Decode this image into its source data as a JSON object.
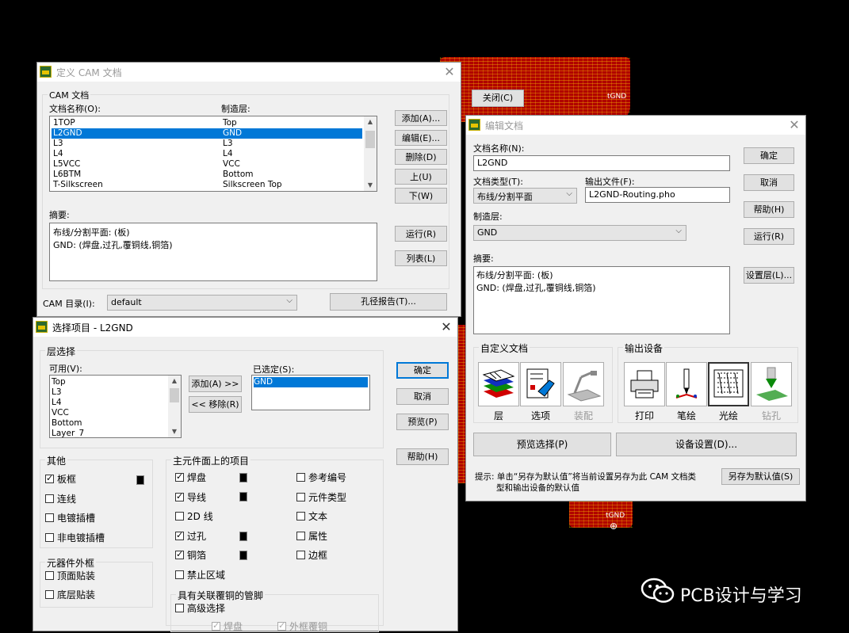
{
  "cam_window": {
    "title": "定义 CAM 文档",
    "group_label": "CAM 文档",
    "col_doc_name": "文档名称(O):",
    "col_layer": "制造层:",
    "documents": [
      {
        "name": "1TOP",
        "layer": "Top"
      },
      {
        "name": "L2GND",
        "layer": "GND",
        "selected": true
      },
      {
        "name": "L3",
        "layer": "L3"
      },
      {
        "name": "L4",
        "layer": "L4"
      },
      {
        "name": "L5VCC",
        "layer": "VCC"
      },
      {
        "name": "L6BTM",
        "layer": "Bottom"
      },
      {
        "name": "T-Silkscreen",
        "layer": "Silkscreen Top"
      }
    ],
    "summary_label": "摘要:",
    "summary_line1": "布线/分割平面: (板)",
    "summary_line2": "GND: (焊盘,过孔,覆铜线,铜箔)",
    "btn_close": "关闭(C)",
    "btn_add": "添加(A)...",
    "btn_edit": "编辑(E)...",
    "btn_delete": "删除(D)",
    "btn_up": "上(U)",
    "btn_down": "下(W)",
    "btn_run": "运行(R)",
    "btn_list": "列表(L)",
    "dir_label": "CAM 目录(I):",
    "dir_value": "default",
    "btn_drill_report": "孔径报告(T)..."
  },
  "edit_window": {
    "title": "编辑文档",
    "doc_name_label": "文档名称(N):",
    "doc_name_value": "L2GND",
    "doc_type_label": "文档类型(T):",
    "doc_type_value": "布线/分割平面",
    "output_file_label": "输出文件(F):",
    "output_file_value": "L2GND-Routing.pho",
    "layer_label": "制造层:",
    "layer_value": "GND",
    "summary_label": "摘要:",
    "summary_line1": "布线/分割平面: (板)",
    "summary_line2": "GND: (焊盘,过孔,覆铜线,铜箔)",
    "btn_ok": "确定",
    "btn_cancel": "取消",
    "btn_help": "帮助(H)",
    "btn_run": "运行(R)",
    "btn_layers": "设置层(L)...",
    "custom_group": "自定义文档",
    "custom_items": [
      "层",
      "选项",
      "装配"
    ],
    "output_group": "输出设备",
    "output_items": [
      "打印",
      "笔绘",
      "光绘",
      "钻孔"
    ],
    "btn_preview": "预览选择(P)",
    "btn_device_setup": "设备设置(D)...",
    "hint_line1": "提示: 单击“另存为默认值”将当前设置另存为此 CAM 文档类",
    "hint_line2": "型和输出设备的默认值",
    "btn_save_default": "另存为默认值(S)"
  },
  "select_window": {
    "title": "选择项目 - L2GND",
    "layer_group": "层选择",
    "available_label": "可用(V):",
    "available": [
      "Top",
      "L3",
      "L4",
      "VCC",
      "Bottom",
      "Layer_7"
    ],
    "selected_label": "已选定(S):",
    "selected": [
      "GND"
    ],
    "btn_add": "添加(A) >>",
    "btn_remove": "<< 移除(R)",
    "btn_ok": "确定",
    "btn_cancel": "取消",
    "btn_preview": "预览(P)",
    "btn_help": "帮助(H)",
    "other_group": "其他",
    "other_items": [
      {
        "label": "板框",
        "checked": true
      },
      {
        "label": "连线",
        "checked": false
      },
      {
        "label": "电镀插槽",
        "checked": false
      },
      {
        "label": "非电镀插槽",
        "checked": false
      }
    ],
    "outline_group": "元器件外框",
    "outline_items": [
      {
        "label": "顶面贴装",
        "checked": false
      },
      {
        "label": "底层贴装",
        "checked": false
      }
    ],
    "main_group": "主元件面上的项目",
    "main_col1": [
      {
        "label": "焊盘",
        "checked": true
      },
      {
        "label": "导线",
        "checked": true
      },
      {
        "label": "2D 线",
        "checked": false
      },
      {
        "label": "过孔",
        "checked": true
      },
      {
        "label": "铜箔",
        "checked": true
      },
      {
        "label": "禁止区域",
        "checked": false
      }
    ],
    "main_col2": [
      {
        "label": "参考编号",
        "checked": false
      },
      {
        "label": "元件类型",
        "checked": false
      },
      {
        "label": "文本",
        "checked": false
      },
      {
        "label": "属性",
        "checked": false
      },
      {
        "label": "边框",
        "checked": false
      }
    ],
    "pin_group": "具有关联覆铜的管脚",
    "advanced": {
      "label": "高级选择",
      "checked": false
    },
    "sub_items": [
      {
        "label": "焊盘",
        "checked": true
      },
      {
        "label": "外框覆铜",
        "checked": true
      }
    ]
  },
  "background": {
    "pcb_labels": [
      "tGND",
      "tGND"
    ],
    "watermark": "PCB设计与学习"
  }
}
